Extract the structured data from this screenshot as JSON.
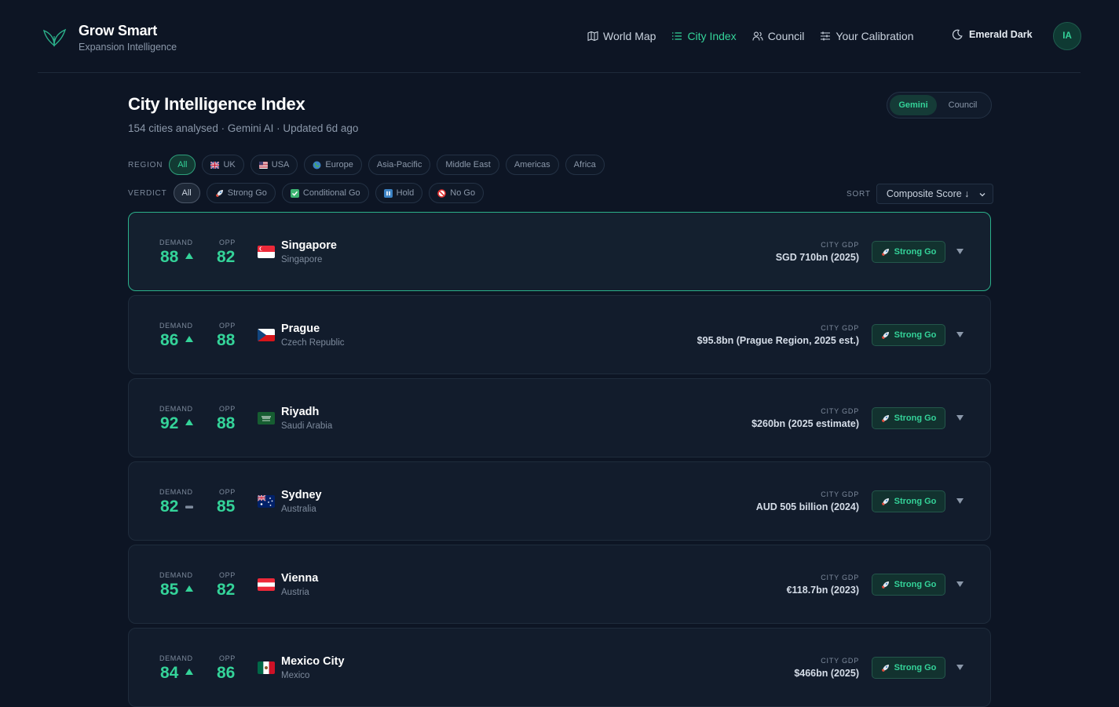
{
  "brand": {
    "title": "Grow Smart",
    "subtitle": "Expansion Intelligence",
    "icon": "leaf-icon"
  },
  "nav": [
    {
      "label": "World Map",
      "icon": "map-icon",
      "active": false
    },
    {
      "label": "City Index",
      "icon": "list-icon",
      "active": true
    },
    {
      "label": "Council",
      "icon": "users-icon",
      "active": false
    },
    {
      "label": "Your Calibration",
      "icon": "sliders-icon",
      "active": false
    }
  ],
  "theme": {
    "label": "Emerald Dark",
    "icon": "moon-icon"
  },
  "avatar": {
    "initials": "IA"
  },
  "page": {
    "title": "City Intelligence Index",
    "subtitle": "154 cities analysed · Gemini AI · Updated 6d ago"
  },
  "source_toggle": {
    "options": [
      "Gemini",
      "Council"
    ],
    "selected": "Gemini"
  },
  "filters": {
    "region_label": "REGION",
    "region": [
      "All",
      "UK",
      "USA",
      "Europe",
      "Asia-Pacific",
      "Middle East",
      "Americas",
      "Africa"
    ],
    "verdict_label": "VERDICT",
    "verdict": [
      "All",
      "Strong Go",
      "Conditional Go",
      "Hold",
      "No Go"
    ]
  },
  "sort": {
    "label": "SORT",
    "value": "Composite Score ↓"
  },
  "metric_labels": {
    "demand": "DEMAND",
    "opp": "OPP",
    "gdp": "CITY GDP"
  },
  "cities": [
    {
      "name": "Singapore",
      "country": "Singapore",
      "demand": "88",
      "trend": "up",
      "opp": "82",
      "gdp": "SGD 710bn (2025)",
      "verdict": "Strong Go",
      "flag": "sg"
    },
    {
      "name": "Prague",
      "country": "Czech Republic",
      "demand": "86",
      "trend": "up",
      "opp": "88",
      "gdp": "$95.8bn (Prague Region, 2025 est.)",
      "verdict": "Strong Go",
      "flag": "cz"
    },
    {
      "name": "Riyadh",
      "country": "Saudi Arabia",
      "demand": "92",
      "trend": "up",
      "opp": "88",
      "gdp": "$260bn (2025 estimate)",
      "verdict": "Strong Go",
      "flag": "sa"
    },
    {
      "name": "Sydney",
      "country": "Australia",
      "demand": "82",
      "trend": "flat",
      "opp": "85",
      "gdp": "AUD 505 billion (2024)",
      "verdict": "Strong Go",
      "flag": "au"
    },
    {
      "name": "Vienna",
      "country": "Austria",
      "demand": "85",
      "trend": "up",
      "opp": "82",
      "gdp": "€118.7bn (2023)",
      "verdict": "Strong Go",
      "flag": "at"
    },
    {
      "name": "Mexico City",
      "country": "Mexico",
      "demand": "84",
      "trend": "up",
      "opp": "86",
      "gdp": "$466bn (2025)",
      "verdict": "Strong Go",
      "flag": "mx"
    }
  ]
}
